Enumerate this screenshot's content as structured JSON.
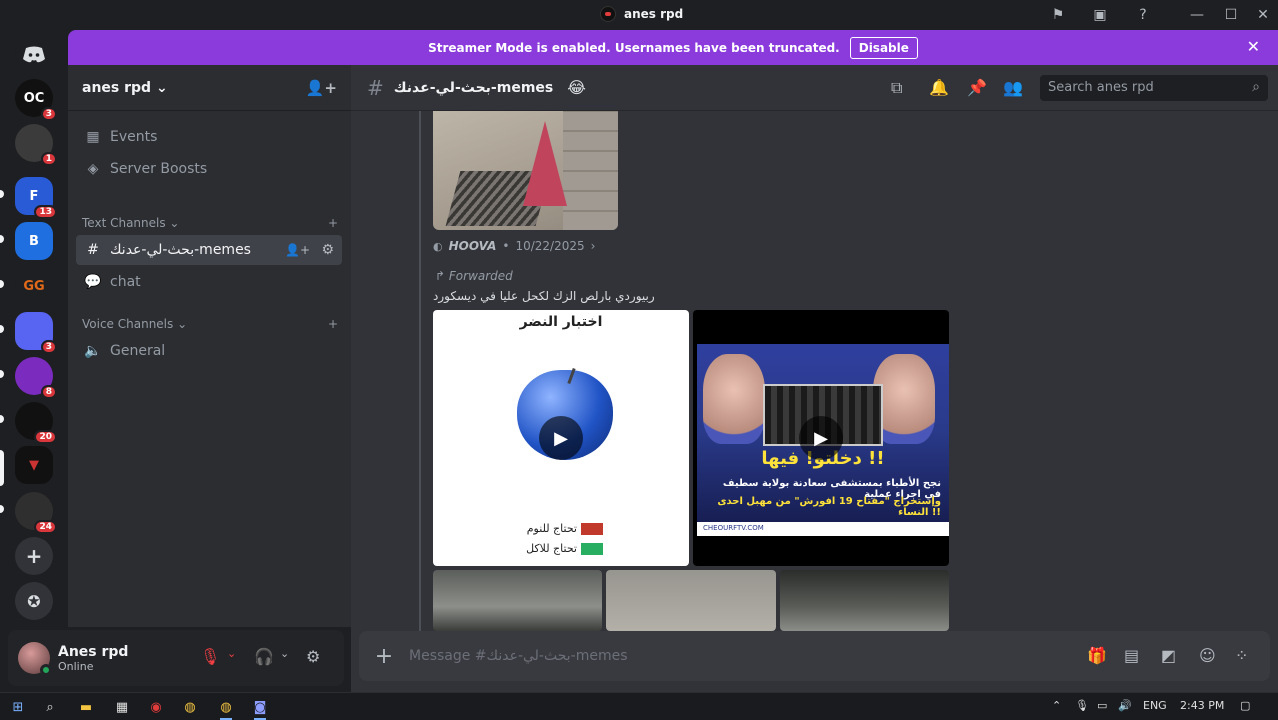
{
  "window": {
    "title": "anes rpd",
    "controls": [
      "minimize",
      "maximize",
      "close"
    ]
  },
  "banner": {
    "message": "Streamer Mode is enabled. Usernames have been truncated.",
    "button": "Disable",
    "close_icon": "close-icon"
  },
  "guilds": [
    {
      "label": "OC",
      "badge": "3",
      "color": "#111111"
    },
    {
      "label": "",
      "badge": "1",
      "color": "#3b3b3b"
    },
    {
      "label": "F",
      "badge": "13",
      "color": "#2a5bd7"
    },
    {
      "label": "B",
      "badge": "",
      "color": "#1f6fe0"
    },
    {
      "label": "GG",
      "badge": "",
      "color": "#e06a1a"
    },
    {
      "label": "",
      "badge": "3",
      "color": "#5865f2"
    },
    {
      "label": "",
      "badge": "8",
      "color": "#7b2cbf"
    },
    {
      "label": "",
      "badge": "20",
      "color": "#111111"
    },
    {
      "label": "",
      "badge": "",
      "color": "#111111"
    },
    {
      "label": "",
      "badge": "24",
      "color": "#2f2f2f"
    }
  ],
  "sidebar": {
    "server_name": "anes rpd",
    "items": [
      {
        "label": "Events",
        "icon": "calendar-icon"
      },
      {
        "label": "Server Boosts",
        "icon": "boost-icon"
      }
    ],
    "text_category": "Text Channels",
    "text_channels": [
      {
        "label": "بحث-لي-عدنك-memes",
        "active": true
      },
      {
        "label": "chat",
        "active": false
      }
    ],
    "voice_category": "Voice Channels",
    "voice_channels": [
      {
        "label": "General"
      }
    ]
  },
  "user": {
    "name": "Anes rpd",
    "status": "Online"
  },
  "channel_header": {
    "name": "بحث-لي-عدنك-memes",
    "emoji": "😂",
    "search_placeholder": "Search anes rpd"
  },
  "messages": {
    "author": "HOOVA",
    "date": "10/22/2025",
    "forwarded_label": "Forwarded",
    "forwarded_text": "ربيوردي بارلص الزك لكحل عليا في ديسكورد",
    "media1": {
      "title": "اختبار النضر",
      "legend": [
        {
          "label": "تحتاج للنوم",
          "color": "#c0392b"
        },
        {
          "label": "تحتاج للاكل",
          "color": "#27ae60"
        }
      ]
    },
    "media2": {
      "headline": "دخلتو! فيها !!",
      "sub1": "نجح الأطباء بمستشفى سعادنة بولاية سطيف في اجراء عملية",
      "sub2": "وإستخراج \"مفتاح 19 افورش\" من مهبل احدى النساء !!",
      "footer": "CHEOURFTV.COM"
    }
  },
  "composer": {
    "placeholder": "Message #بحث-لي-عدنك-memes"
  },
  "taskbar": {
    "lang": "ENG",
    "time": "2:43 PM"
  }
}
